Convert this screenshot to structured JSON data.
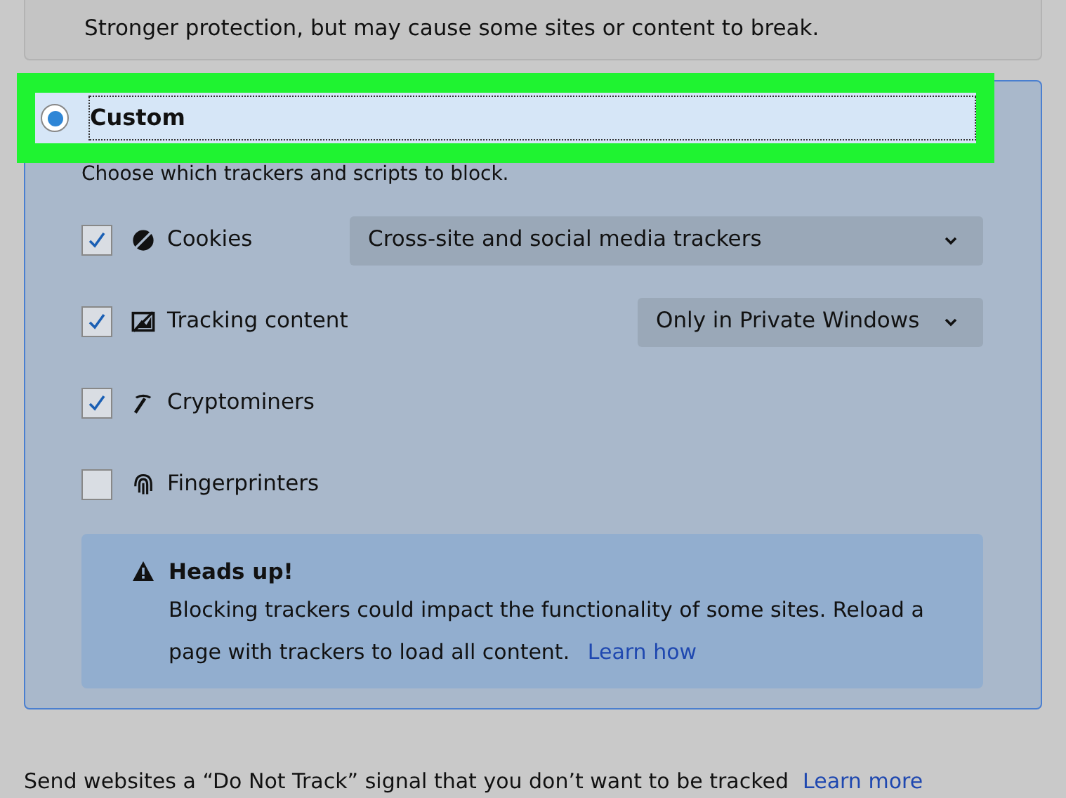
{
  "strict_option": {
    "description": "Stronger protection, but may cause some sites or content to break."
  },
  "custom_option": {
    "label": "Custom",
    "selected": true,
    "highlighted": true,
    "description": "Choose which trackers and scripts to block.",
    "trackers": [
      {
        "kind": "cookies",
        "label": "Cookies",
        "checked": true,
        "dropdown": "Cross-site and social media trackers"
      },
      {
        "kind": "tracking",
        "label": "Tracking content",
        "checked": true,
        "dropdown": "Only in Private Windows"
      },
      {
        "kind": "crypto",
        "label": "Cryptominers",
        "checked": true
      },
      {
        "kind": "finger",
        "label": "Fingerprinters",
        "checked": false
      }
    ],
    "notice": {
      "title": "Heads up!",
      "text": "Blocking trackers could impact the functionality of some sites. Reload a page with trackers to load all content.",
      "link": "Learn how"
    }
  },
  "do_not_track": {
    "text": "Send websites a “Do Not Track” signal that you don’t want to be tracked",
    "link": "Learn more"
  }
}
